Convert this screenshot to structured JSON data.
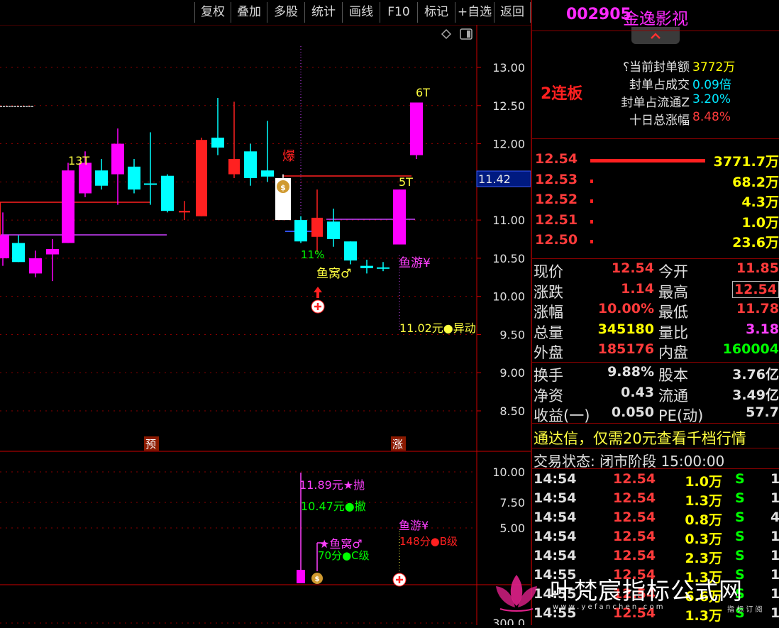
{
  "toolbar": {
    "buttons": [
      "复权",
      "叠加",
      "多股",
      "统计",
      "画线",
      "F10",
      "标记",
      "+自选",
      "返回"
    ],
    "icons": [
      "diamond-icon",
      "window-icon"
    ]
  },
  "chart": {
    "price_axis": [
      "13.00",
      "12.50",
      "12.00",
      "11.50",
      "11.00",
      "10.50",
      "10.00",
      "9.50",
      "9.00",
      "8.50"
    ],
    "current_price_tag": "11.42",
    "lower_axis": [
      "10.00",
      "7.50",
      "5.00",
      "300.0"
    ],
    "annotations": {
      "t13": "13T",
      "t6": "6T",
      "t5": "5T",
      "bao": "爆",
      "pct11": "11%",
      "yuwo": "鱼窝♂",
      "yuyou": "鱼游¥",
      "yidong": "11.02元●异动",
      "yu": "预",
      "zhang": "涨"
    },
    "lower_annotations": {
      "pao": "11.89元★抛",
      "che": "10.47元●撤",
      "yuwo2": "★鱼窝♂",
      "c_level": "70分●C级",
      "yuyou2": "鱼游¥",
      "b_level": "148分●B级"
    },
    "colors": {
      "up": "#ff00ff",
      "down": "#00ffff",
      "red": "#ff2020",
      "axis": "#cc0000"
    }
  },
  "panel": {
    "code": "002905",
    "name": "金逸影视",
    "lianban": "2连板",
    "seal_info": [
      {
        "label": "⸮当前封单额",
        "value": "3772万",
        "color": "yellow"
      },
      {
        "label": "封单占成交",
        "value": "0.09倍",
        "color": "cyan"
      },
      {
        "label": "封单占流通Z",
        "value": "3.20%",
        "color": "cyan"
      },
      {
        "label": "十日总涨幅",
        "value": "8.48%",
        "color": "red"
      }
    ],
    "bids": [
      {
        "price": "12.54",
        "vol": "3771.7万",
        "bar": 1.0
      },
      {
        "price": "12.53",
        "vol": "68.2万",
        "bar": 0.02
      },
      {
        "price": "12.52",
        "vol": "4.3万",
        "bar": 0.01
      },
      {
        "price": "12.51",
        "vol": "1.0万",
        "bar": 0.01
      },
      {
        "price": "12.50",
        "vol": "23.6万",
        "bar": 0.01
      }
    ],
    "quote": [
      {
        "l1": "现价",
        "v1": "12.54",
        "c1": "red",
        "l2": "今开",
        "v2": "11.85",
        "c2": "red"
      },
      {
        "l1": "涨跌",
        "v1": "1.14",
        "c1": "red",
        "l2": "最高",
        "v2": "12.54",
        "c2": "red"
      },
      {
        "l1": "涨幅",
        "v1": "10.00%",
        "c1": "red",
        "l2": "最低",
        "v2": "11.78",
        "c2": "red"
      },
      {
        "l1": "总量",
        "v1": "345180",
        "c1": "yellow",
        "l2": "量比",
        "v2": "3.18",
        "c2": "mag"
      },
      {
        "l1": "外盘",
        "v1": "185176",
        "c1": "red",
        "l2": "内盘",
        "v2": "160004",
        "c2": "green"
      }
    ],
    "fund": [
      {
        "l1": "换手",
        "v1": "9.88%",
        "l2": "股本",
        "v2": "3.76亿"
      },
      {
        "l1": "净资",
        "v1": "0.43",
        "l2": "流通",
        "v2": "3.49亿"
      },
      {
        "l1": "收益(一)",
        "v1": "0.050",
        "l2": "PE(动)",
        "v2": "57.7"
      }
    ],
    "promo": "通达信，仅需20元查看千档行情",
    "status": "交易状态: 闭市阶段 15:00:00",
    "trades": [
      {
        "time": "14:54",
        "price": "12.54",
        "vol": "1.0万",
        "bs": "S",
        "n": "1"
      },
      {
        "time": "14:54",
        "price": "12.54",
        "vol": "1.3万",
        "bs": "S",
        "n": "1"
      },
      {
        "time": "14:54",
        "price": "12.54",
        "vol": "0.8万",
        "bs": "S",
        "n": "4"
      },
      {
        "time": "14:54",
        "price": "12.54",
        "vol": "0.3万",
        "bs": "S",
        "n": "1"
      },
      {
        "time": "14:54",
        "price": "12.54",
        "vol": "2.3万",
        "bs": "S",
        "n": "1"
      },
      {
        "time": "14:55",
        "price": "12.54",
        "vol": "1.3万",
        "bs": "S",
        "n": "1"
      },
      {
        "time": "14:55",
        "price": "12.54",
        "vol": "6.6万",
        "bs": "S",
        "n": "1"
      },
      {
        "time": "14:55",
        "price": "12.54",
        "vol": "1.3万",
        "bs": "S",
        "n": "1"
      }
    ]
  },
  "watermark": {
    "text": "叶梵宸指标公式网",
    "url": "w w w . y e f a n c h e n . c o m",
    "sub": "指 标 订 阅"
  }
}
